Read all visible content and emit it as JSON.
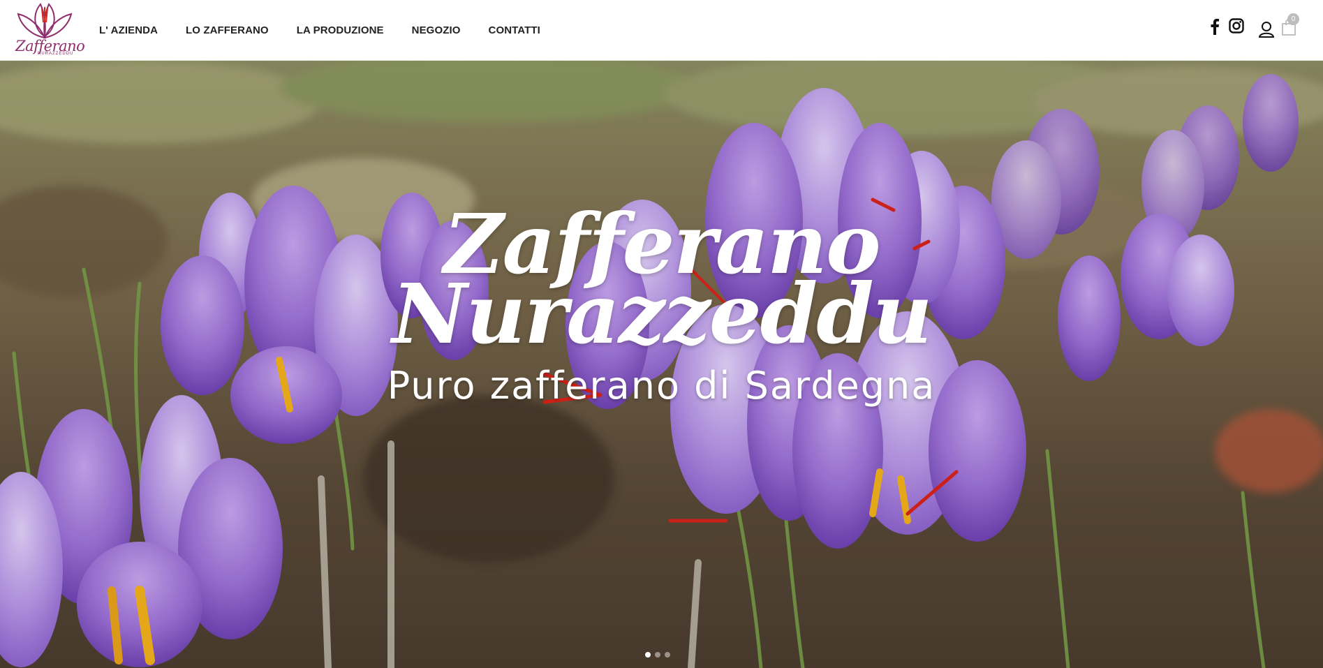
{
  "brand": {
    "logo_text": "Zafferano",
    "logo_sub": "NURAZZEDDU",
    "color": "#8e2d6b"
  },
  "nav": {
    "items": [
      {
        "label": "L' AZIENDA"
      },
      {
        "label": "LO ZAFFERANO"
      },
      {
        "label": "LA PRODUZIONE"
      },
      {
        "label": "NEGOZIO"
      },
      {
        "label": "CONTATTI"
      }
    ]
  },
  "tools": {
    "facebook_icon": "facebook-icon",
    "instagram_icon": "instagram-icon",
    "user_icon": "user-icon",
    "cart_icon": "shopping-bag-icon",
    "cart_count": "0"
  },
  "hero": {
    "title_line1": "Zafferano",
    "title_line2": "Nurazzeddu",
    "subtitle": "Puro zafferano di Sardegna",
    "slides": 3,
    "active_slide": 1,
    "flower_color": "#9b6fd6",
    "stigma_color": "#e0231b"
  }
}
